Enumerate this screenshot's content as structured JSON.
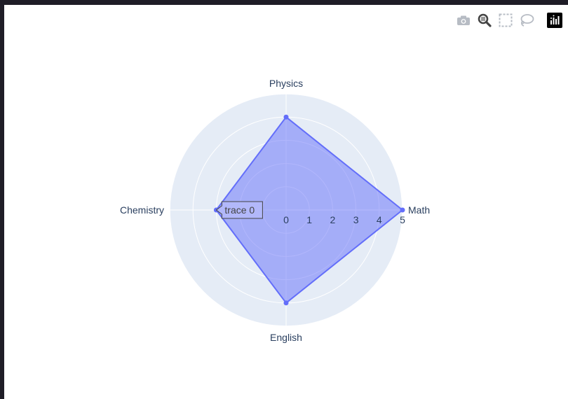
{
  "toolbar": {
    "buttons": [
      {
        "icon": "camera-icon"
      },
      {
        "icon": "zoom-icon"
      },
      {
        "icon": "box-select-icon"
      },
      {
        "icon": "lasso-select-icon"
      },
      {
        "icon": "plotly-logo-icon"
      }
    ]
  },
  "colors": {
    "polar_bg": "#e5ecf6",
    "grid": "#ffffff",
    "trace_line": "#636efa",
    "trace_fill": "rgba(99,110,250,0.5)",
    "text": "#2a3f5f"
  },
  "chart_data": {
    "type": "radar",
    "categories": [
      "Math",
      "Physics",
      "Chemistry",
      "English"
    ],
    "series": [
      {
        "name": "trace 0",
        "values": [
          5,
          4,
          3,
          4
        ]
      }
    ],
    "radial_range": [
      0,
      5
    ],
    "radial_ticks": [
      "0",
      "1",
      "2",
      "3",
      "4",
      "5"
    ],
    "hover_label": "trace 0"
  }
}
